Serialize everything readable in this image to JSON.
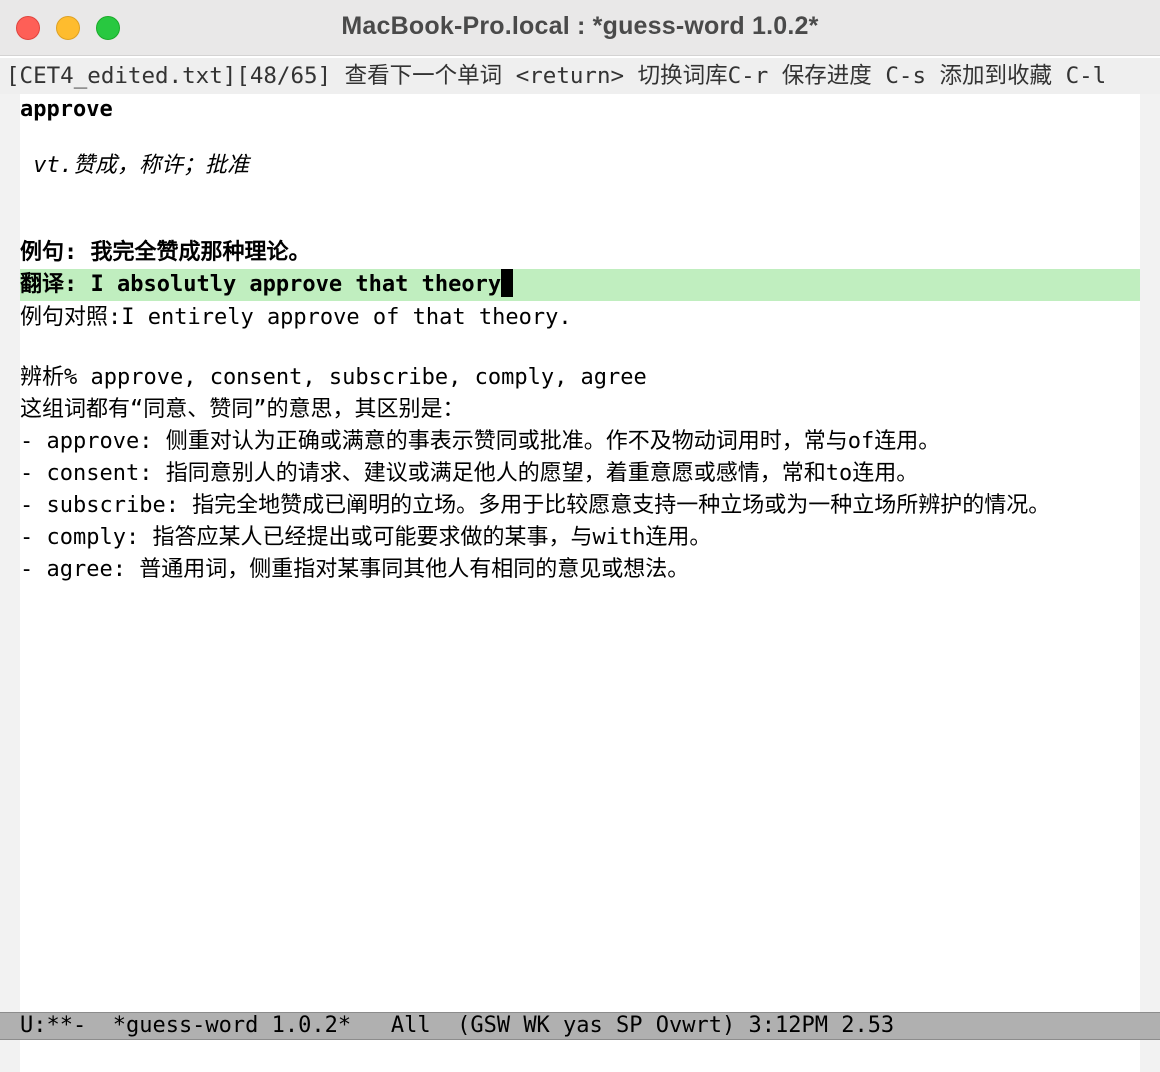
{
  "window": {
    "title": "MacBook-Pro.local : *guess-word 1.0.2*"
  },
  "header_line": "[CET4_edited.txt][48/65] 查看下一个单词 <return> 切换词库C-r 保存进度 C-s 添加到收藏 C-l",
  "buffer": {
    "word": "approve",
    "definition": " vt.赞成，称许；批准",
    "example": "例句: 我完全赞成那种理论。",
    "translation": "翻译: I absolutly approve that theory",
    "example_reference": "例句对照:I entirely approve of that theory.",
    "analysis_heading": "辨析% approve, consent, subscribe, comply, agree",
    "analysis_intro": "这组词都有“同意、赞同”的意思，其区别是：",
    "analysis_items": [
      "- approve: 侧重对认为正确或满意的事表示赞同或批准。作不及物动词用时，常与of连用。",
      "- consent: 指同意别人的请求、建议或满足他人的愿望，着重意愿或感情，常和to连用。",
      "- subscribe: 指完全地赞成已阐明的立场。多用于比较愿意支持一种立场或为一种立场所辨护的情况。",
      "- comply: 指答应某人已经提出或可能要求做的某事，与with连用。",
      "- agree: 普通用词，侧重指对某事同其他人有相同的意见或想法。"
    ]
  },
  "mode_line": "U:**-  *guess-word 1.0.2*   All  (GSW WK yas SP Ovwrt) 3:12PM 2.53",
  "colors": {
    "highlight": "#c0eebf",
    "mode_line_bg": "#b0b0b0"
  }
}
